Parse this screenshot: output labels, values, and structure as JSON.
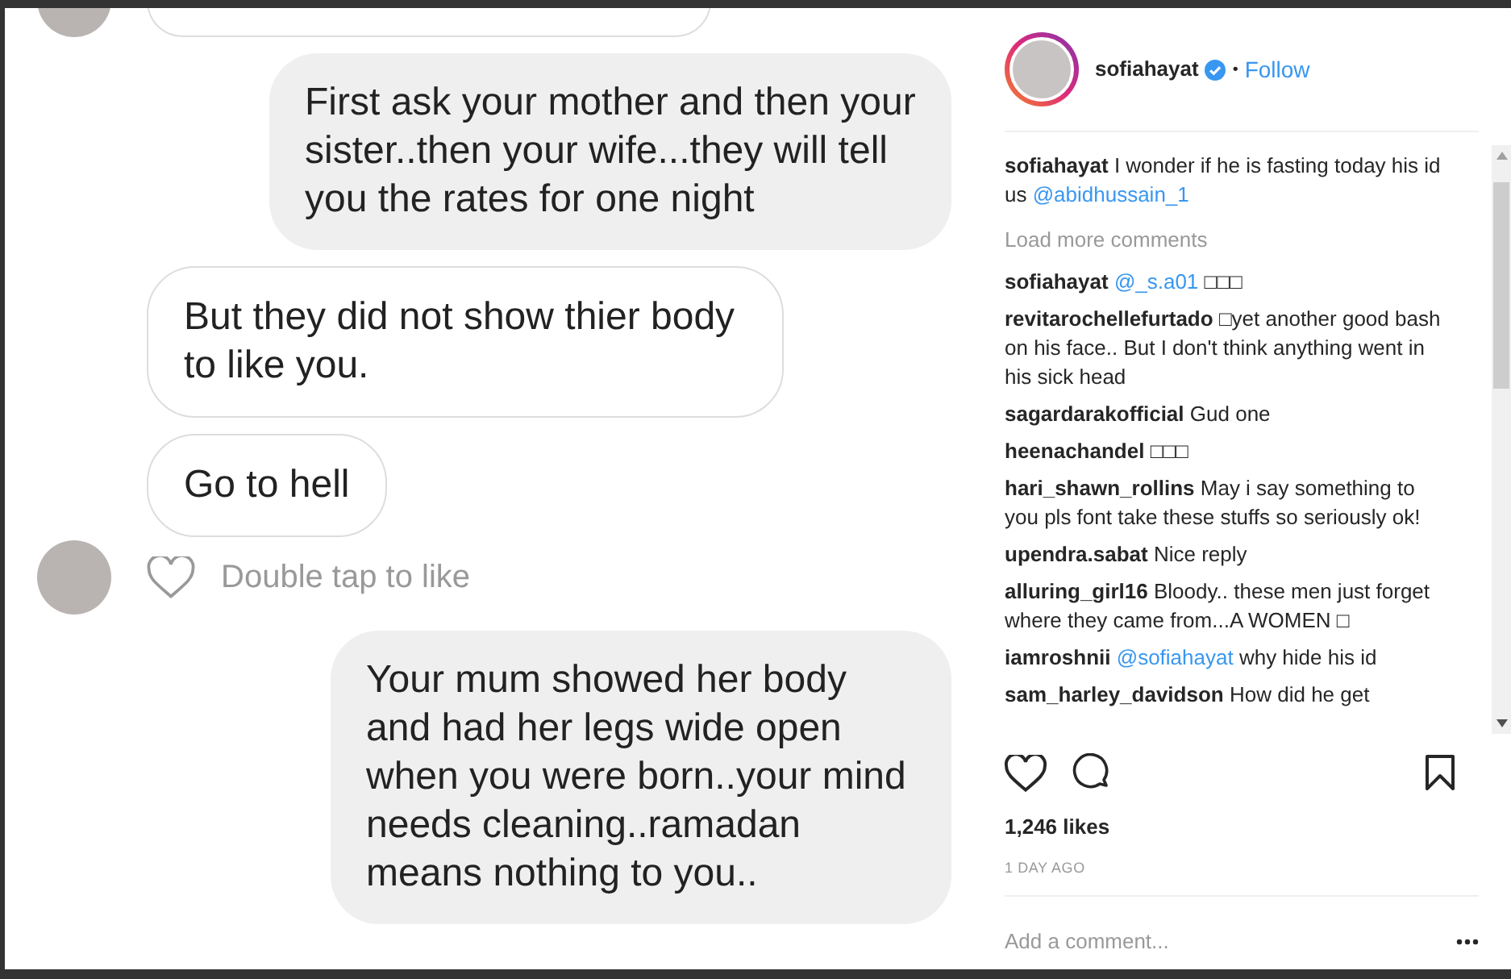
{
  "chat": {
    "messages": [
      {
        "kind": "partial"
      },
      {
        "kind": "sent",
        "text": "First ask your mother and then your sister..then your wife...they will tell you the rates for one night"
      },
      {
        "kind": "received",
        "text": "But they did not show thier body to like you."
      },
      {
        "kind": "received",
        "text": "Go to hell"
      },
      {
        "kind": "like_hint",
        "text": "Double tap to like"
      },
      {
        "kind": "sent",
        "text": "Your mum showed her body and had her legs wide open when you were born..your mind needs cleaning..ramadan means nothing to you.."
      }
    ]
  },
  "post": {
    "username": "sofiahayat",
    "verified": true,
    "separator": "•",
    "follow": "Follow",
    "comments": [
      {
        "kind": "caption",
        "user": "sofiahayat",
        "parts": [
          {
            "kind": "text",
            "text": "I wonder if he is fasting today his id us "
          },
          {
            "kind": "mention",
            "text": "@abidhussain_1"
          }
        ]
      },
      {
        "kind": "load_more",
        "text": "Load more comments"
      },
      {
        "kind": "comment",
        "user": "sofiahayat",
        "parts": [
          {
            "kind": "mention",
            "text": "@_s.a01"
          },
          {
            "kind": "text",
            "text": " □□□"
          }
        ]
      },
      {
        "kind": "comment",
        "user": "revitarochellefurtado",
        "parts": [
          {
            "kind": "text",
            "text": "□yet another good bash on his face.. But I don't think anything went in his sick head"
          }
        ]
      },
      {
        "kind": "comment",
        "user": "sagardarakofficial",
        "parts": [
          {
            "kind": "text",
            "text": "Gud one"
          }
        ]
      },
      {
        "kind": "comment",
        "user": "heenachandel",
        "parts": [
          {
            "kind": "text",
            "text": "□□□"
          }
        ]
      },
      {
        "kind": "comment",
        "user": "hari_shawn_rollins",
        "parts": [
          {
            "kind": "text",
            "text": "May i say something to you pls font take these stuffs so seriously ok!"
          }
        ]
      },
      {
        "kind": "comment",
        "user": "upendra.sabat",
        "parts": [
          {
            "kind": "text",
            "text": "Nice reply"
          }
        ]
      },
      {
        "kind": "comment",
        "user": "alluring_girl16",
        "parts": [
          {
            "kind": "text",
            "text": "Bloody.. these men just forget where they came from...A WOMEN □"
          }
        ]
      },
      {
        "kind": "comment",
        "user": "iamroshnii",
        "parts": [
          {
            "kind": "mention",
            "text": "@sofiahayat"
          },
          {
            "kind": "text",
            "text": " why hide his id"
          }
        ]
      },
      {
        "kind": "comment",
        "user": "sam_harley_davidson",
        "parts": [
          {
            "kind": "text",
            "text": " How did he get"
          }
        ]
      }
    ],
    "likes": "1,246 likes",
    "time": "1 DAY AGO",
    "comment_placeholder": "Add a comment..."
  }
}
